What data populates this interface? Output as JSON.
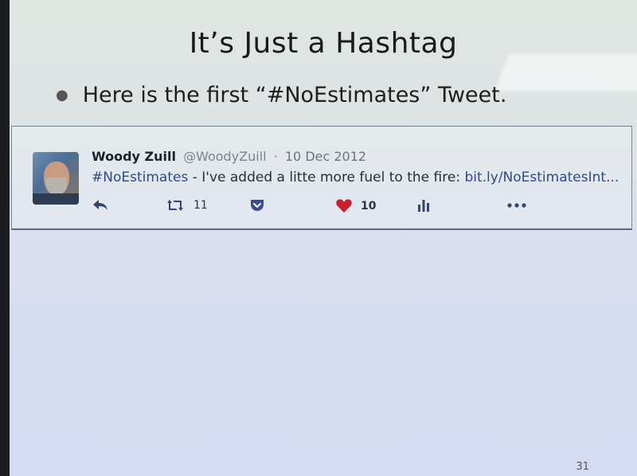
{
  "slide": {
    "title": "It’s Just a Hashtag",
    "bullet": "Here is the first “#NoEstimates” Tweet.",
    "page_number": "31"
  },
  "tweet": {
    "name": "Woody Zuill",
    "handle": "@WoodyZuill",
    "separator": "·",
    "date": "10 Dec 2012",
    "hashtag": "#NoEstimates",
    "text": " - I've added a litte more fuel to the fire: ",
    "link": "bit.ly/NoEstimatesInt...",
    "retweets": "11",
    "likes": "10",
    "icons": [
      "reply-icon",
      "retweet-icon",
      "pocket-icon",
      "heart-icon",
      "analytics-icon",
      "more-icon"
    ],
    "colors": {
      "link": "#2b4b8c",
      "heart": "#c8202f",
      "pocket": "#3b4d8a"
    }
  }
}
